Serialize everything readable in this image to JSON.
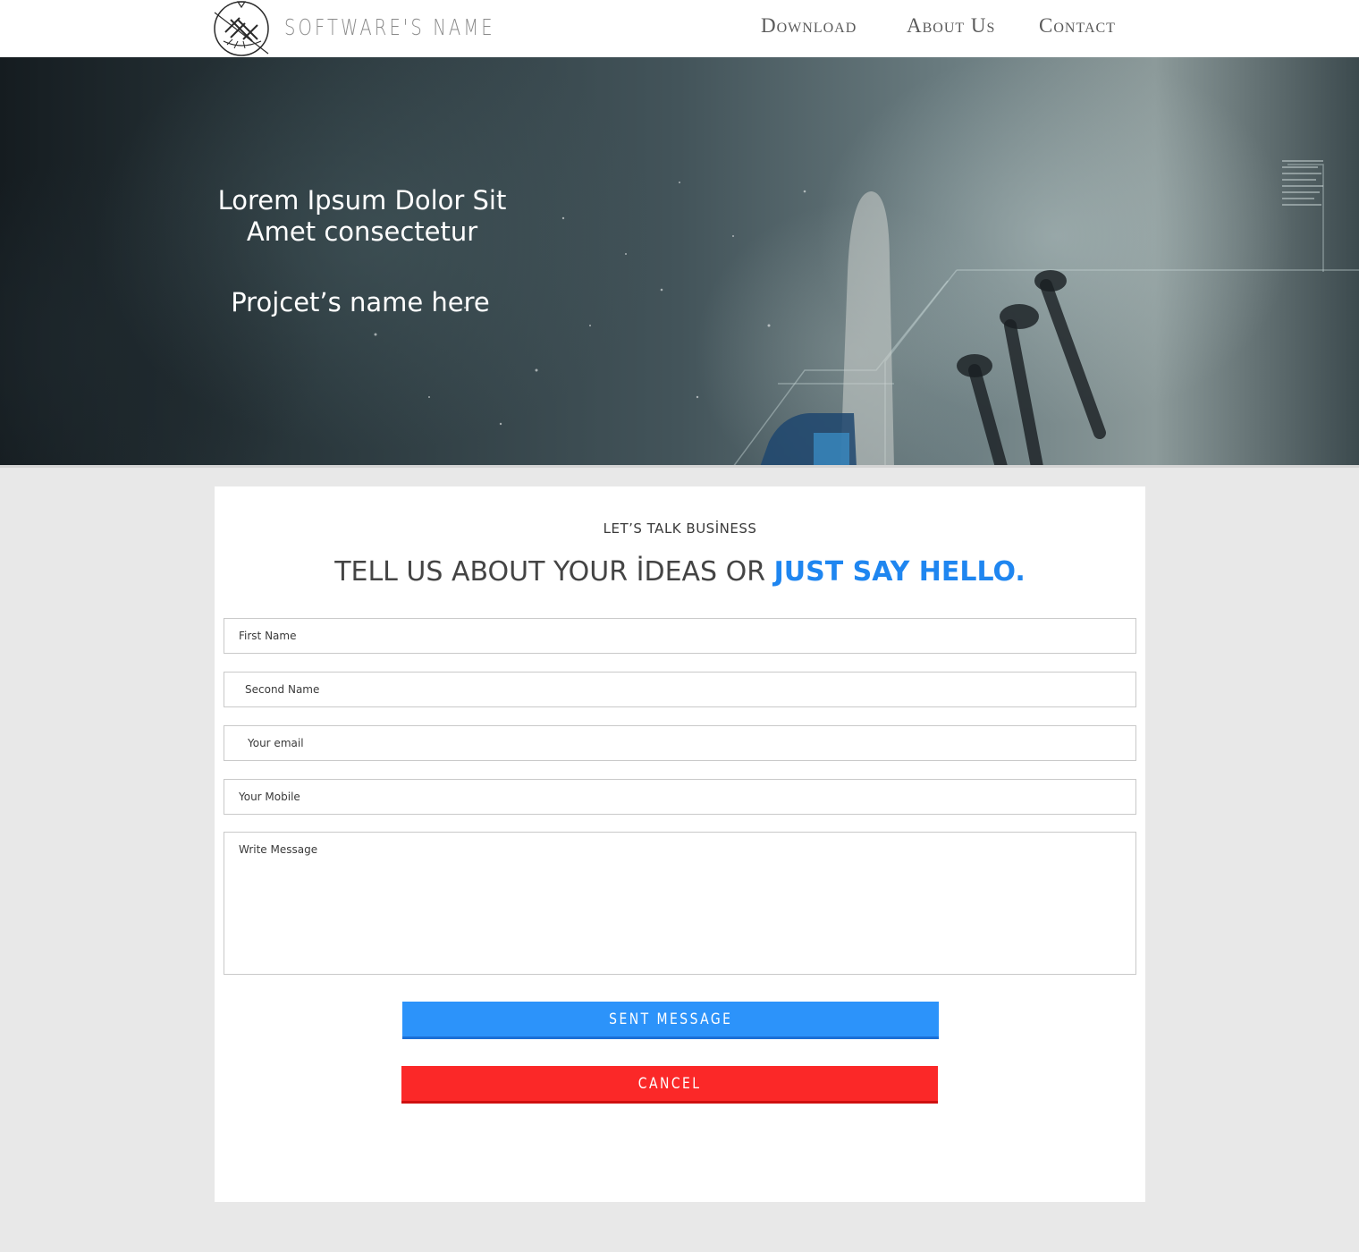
{
  "header": {
    "brand": "Software's Name",
    "nav": {
      "download": "Download",
      "about": "About Us",
      "contact": "Contact"
    }
  },
  "hero": {
    "title_line1": "Lorem Ipsum Dolor Sit",
    "title_line2": "Amet consectetur",
    "project": "Projcet’s name here"
  },
  "contact": {
    "eyebrow": "Let’s talk busİness",
    "headline_prefix": "Tell us about your İdeas or ",
    "headline_accent": "just say hello.",
    "fields": {
      "first_name": "First Name",
      "second_name": "Second Name",
      "email": "Your email",
      "mobile": "Your Mobile",
      "message": "Write Message"
    },
    "send_label": "Sent Message",
    "cancel_label": "Cancel"
  },
  "colors": {
    "accent": "#1f86f0",
    "send_button": "#2c93fa",
    "cancel_button": "#fb2828",
    "page_background": "#e8e8e8"
  }
}
